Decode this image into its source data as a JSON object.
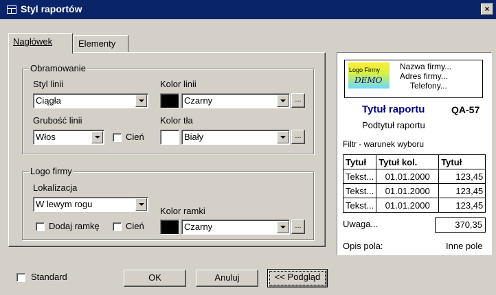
{
  "window": {
    "title": "Styl raportów",
    "close_label": "×"
  },
  "tabs": [
    {
      "label": "Nagłówek",
      "active": true
    },
    {
      "label": "Elementy",
      "active": false
    }
  ],
  "border_group": {
    "title": "Obramowanie",
    "line_style_label": "Styl linii",
    "line_style_value": "Ciągła",
    "line_color_label": "Kolor linii",
    "line_color_value": "Czarny",
    "line_color_hex": "#000000",
    "line_width_label": "Grubość linii",
    "line_width_value": "Włos",
    "shadow_label": "Cień",
    "bg_color_label": "Kolor tła",
    "bg_color_value": "Biały",
    "bg_color_hex": "#ffffff",
    "dots_label": "..."
  },
  "logo_group": {
    "title": "Logo firmy",
    "location_label": "Lokalizacja",
    "location_value": "W lewym rogu",
    "add_frame_label": "Dodaj ramkę",
    "shadow_label": "Cień",
    "frame_color_label": "Kolor ramki",
    "frame_color_value": "Czarny",
    "frame_color_hex": "#000000",
    "dots_label": "..."
  },
  "footer": {
    "standard_label": "Standard",
    "ok_label": "OK",
    "cancel_label": "Anuluj",
    "preview_label": "<< Podgląd"
  },
  "preview": {
    "logo_line1": "Logo Firmy",
    "logo_line2": "DEMO",
    "company_name": "Nazwa firmy...",
    "company_address": "Adres firmy...",
    "company_phones": "Telefony...",
    "report_title": "Tytuł raportu",
    "report_code": "QA-57",
    "report_subtitle": "Podtytuł raportu",
    "filter_text": "Filtr - warunek wyboru",
    "table": {
      "headers": [
        "Tytuł",
        "Tytuł kol.",
        "Tytuł"
      ],
      "rows": [
        [
          "Tekst...",
          "01.01.2000",
          "123,45"
        ],
        [
          "Tekst...",
          "01.01.2000",
          "123,45"
        ],
        [
          "Tekst...",
          "01.01.2000",
          "123,45"
        ]
      ]
    },
    "note_label": "Uwaga...",
    "note_value": "370,35",
    "field_desc_label": "Opis pola:",
    "other_field_label": "Inne pole"
  }
}
